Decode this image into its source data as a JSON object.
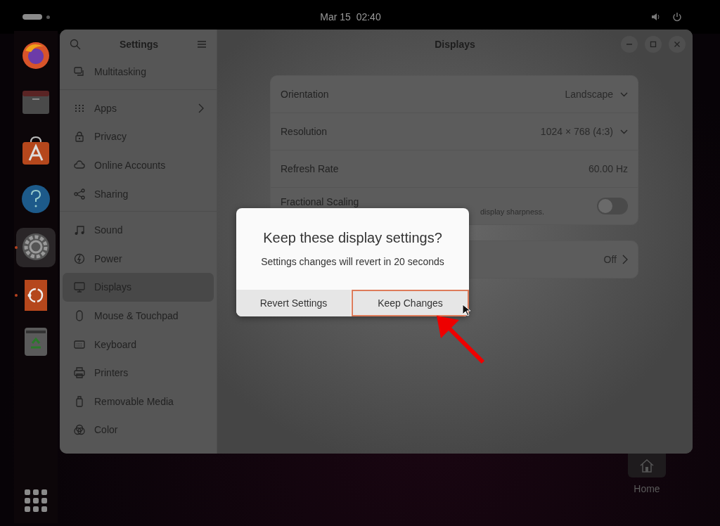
{
  "top_bar": {
    "clock": "Mar 15  02:40"
  },
  "dock": {
    "items": [
      {
        "kind": "firefox",
        "running": false,
        "selected": false
      },
      {
        "kind": "files",
        "running": false,
        "selected": false
      },
      {
        "kind": "app-center",
        "running": false,
        "selected": false
      },
      {
        "kind": "help",
        "running": false,
        "selected": false
      },
      {
        "kind": "settings",
        "running": true,
        "selected": true
      },
      {
        "kind": "ubuntu-pro",
        "running": true,
        "selected": false
      },
      {
        "kind": "trash",
        "running": false,
        "selected": false
      }
    ]
  },
  "window": {
    "sidebar_title": "Settings",
    "title": "Displays"
  },
  "sidebar": {
    "groups": [
      [
        {
          "kind": "multitasking",
          "label": "Multitasking",
          "selected": false,
          "submenu": false
        }
      ],
      [
        {
          "kind": "apps",
          "label": "Apps",
          "selected": false,
          "submenu": true
        },
        {
          "kind": "privacy",
          "label": "Privacy",
          "selected": false,
          "submenu": false
        },
        {
          "kind": "cloud",
          "label": "Online Accounts",
          "selected": false,
          "submenu": false
        },
        {
          "kind": "sharing",
          "label": "Sharing",
          "selected": false,
          "submenu": false
        }
      ],
      [
        {
          "kind": "sound",
          "label": "Sound",
          "selected": false,
          "submenu": false
        },
        {
          "kind": "power",
          "label": "Power",
          "selected": false,
          "submenu": false
        },
        {
          "kind": "displays",
          "label": "Displays",
          "selected": true,
          "submenu": false
        },
        {
          "kind": "mouse",
          "label": "Mouse & Touchpad",
          "selected": false,
          "submenu": false
        },
        {
          "kind": "keyboard",
          "label": "Keyboard",
          "selected": false,
          "submenu": false
        },
        {
          "kind": "printers",
          "label": "Printers",
          "selected": false,
          "submenu": false
        },
        {
          "kind": "media",
          "label": "Removable Media",
          "selected": false,
          "submenu": false
        },
        {
          "kind": "color",
          "label": "Color",
          "selected": false,
          "submenu": false
        }
      ]
    ]
  },
  "display_settings": [
    {
      "kind": "dropdown",
      "label": "Orientation",
      "value": "Landscape"
    },
    {
      "kind": "dropdown",
      "label": "Resolution",
      "value": "1024 × 768 (4:3)"
    },
    {
      "kind": "text",
      "label": "Refresh Rate",
      "value": "60.00 Hz"
    },
    {
      "kind": "switch",
      "label": "Fractional Scaling",
      "subtitle": "display sharpness.",
      "on": false
    }
  ],
  "night_light_row": {
    "value": "Off"
  },
  "dialog": {
    "title": "Keep these display settings?",
    "message": "Settings changes will revert in 20 seconds",
    "buttons": [
      {
        "label": "Revert Settings",
        "focused": false
      },
      {
        "label": "Keep Changes",
        "focused": true
      }
    ]
  },
  "desktop": {
    "icons": [
      {
        "label": "Home"
      }
    ]
  }
}
